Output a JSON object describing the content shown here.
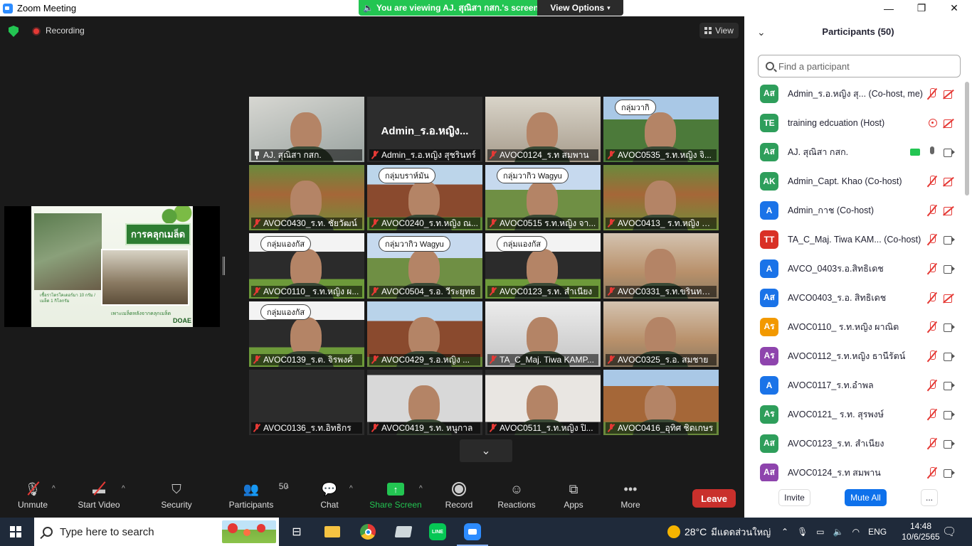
{
  "window": {
    "title": "Zoom Meeting",
    "share_banner": "You are viewing AJ. สุณิสา กสก.'s screen",
    "view_options": "View Options",
    "minimize": "—",
    "restore": "❐",
    "close": "✕"
  },
  "topbar": {
    "recording_label": "Recording",
    "view_label": "View"
  },
  "slide": {
    "title": "การคลุกเมล็ด",
    "caption": "เชื้อราไตรโคเดอร์มา 10 กรัม / เมล็ด 1 กิโลกรัม",
    "caption2": "เพาะเมล็ดหลังจากคลุกเมล็ด",
    "logo": "DOAE"
  },
  "gallery": {
    "tiles": [
      {
        "name": "AJ. สุณิสา กสก.",
        "pinned": true,
        "muted": false,
        "active": true
      },
      {
        "name": "Admin_ร.อ.หญิง สุชรินทร์",
        "big_name": "Admin_ร.อ.หญิง...",
        "muted": true
      },
      {
        "name": "AVOC0124_ร.ท สมพาน",
        "muted": true
      },
      {
        "name": "AVOC0535_ร.ท.หญิง จิ...",
        "bubble": "กลุ่มวากิ",
        "muted": true
      },
      {
        "name": "AVOC0430_ร.ท. ชัยวัฒน์",
        "muted": true
      },
      {
        "name": "AVOC0240_ร.ท.หญิง ณ...",
        "bubble": "กลุ่มบราห์มัน",
        "muted": true
      },
      {
        "name": "AVOC0515 ร.ท.หญิง จา...",
        "bubble": "กลุ่มวากิว Wagyu",
        "muted": true
      },
      {
        "name": "AVOC0413_ ร.ท.หญิง ชั...",
        "muted": true
      },
      {
        "name": "AVOC0110_ ร.ท.หญิง ผ...",
        "bubble": "กลุ่มแองกัส",
        "muted": true
      },
      {
        "name": "AVOC0504_ร.อ. วีระยุทธ",
        "bubble": "กลุ่มวากิว Wagyu",
        "muted": true
      },
      {
        "name": "AVOC0123_ร.ท. สำเนียง",
        "bubble": "กลุ่มแองกัส",
        "muted": true
      },
      {
        "name": "AVOC0331_ร.ท.ขรินทร์ธร",
        "muted": true
      },
      {
        "name": "AVOC0139_ร.ต. จิรพงศ์",
        "bubble": "กลุ่มแองกัส",
        "muted": true
      },
      {
        "name": "AVOC0429_ร.อ.หญิง ...",
        "muted": true
      },
      {
        "name": "TA_C_Maj. Tiwa KAMP...",
        "muted": true
      },
      {
        "name": "AVOC0325_ร.อ. สมชาย",
        "muted": true
      },
      {
        "name": "AVOC0136_ร.ท.อิทธิกร",
        "muted": true
      },
      {
        "name": "AVOC0419_ร.ท. หนูกาล",
        "muted": true
      },
      {
        "name": "AVOC0511_ร.ท.หญิง ปิ...",
        "muted": true
      },
      {
        "name": "AVOC0416_อุทิศ ชิดเกษร",
        "muted": true
      }
    ]
  },
  "toolbar": {
    "unmute": "Unmute",
    "start_video": "Start Video",
    "security": "Security",
    "participants": "Participants",
    "participants_count": "50",
    "chat": "Chat",
    "share_screen": "Share Screen",
    "record": "Record",
    "reactions": "Reactions",
    "apps": "Apps",
    "more": "More",
    "leave": "Leave"
  },
  "panel": {
    "title": "Participants (50)",
    "search_placeholder": "Find a participant",
    "participants": [
      {
        "initials": "Aส",
        "color": "#2e9e5b",
        "name": "Admin_ร.อ.หญิง สุ...  (Co-host, me)",
        "mic": "muted",
        "cam": "off"
      },
      {
        "initials": "TE",
        "color": "#2e9e5b",
        "name": "training edcuation (Host)",
        "mic": "rec",
        "cam": "off"
      },
      {
        "initials": "Aส",
        "color": "#2e9e5b",
        "name": "AJ. สุณิสา กสก.",
        "mic": "on",
        "cam": "on",
        "sharing": true
      },
      {
        "initials": "AK",
        "color": "#2e9e5b",
        "name": "Admin_Capt. Khao (Co-host)",
        "mic": "muted",
        "cam": "off"
      },
      {
        "initials": "A",
        "color": "#1a73e8",
        "name": "Admin_กาช (Co-host)",
        "mic": "muted",
        "cam": "off"
      },
      {
        "initials": "TT",
        "color": "#d93025",
        "name": "TA_C_Maj. Tiwa KAM...  (Co-host)",
        "mic": "muted",
        "cam": "on"
      },
      {
        "initials": "A",
        "color": "#1a73e8",
        "name": "AVCO_0403ร.อ.สิทธิเดช",
        "mic": "muted",
        "cam": "on"
      },
      {
        "initials": "Aส",
        "color": "#1a73e8",
        "name": "AVCO0403_ร.อ. สิทธิเดช",
        "mic": "muted",
        "cam": "off"
      },
      {
        "initials": "Aร",
        "color": "#f29900",
        "name": "AVOC0110_ ร.ท.หญิง ผาณิต",
        "mic": "muted",
        "cam": "on"
      },
      {
        "initials": "Aร",
        "color": "#8e44ad",
        "name": "AVOC0112_ร.ท.หญิง ธานีรัตน์",
        "mic": "muted",
        "cam": "on"
      },
      {
        "initials": "A",
        "color": "#1a73e8",
        "name": "AVOC0117_ร.ท.อำพล",
        "mic": "muted",
        "cam": "on"
      },
      {
        "initials": "Aร",
        "color": "#2e9e5b",
        "name": "AVOC0121_ ร.ท. สุรพงษ์",
        "mic": "muted",
        "cam": "on"
      },
      {
        "initials": "Aส",
        "color": "#2e9e5b",
        "name": "AVOC0123_ร.ท. สำเนียง",
        "mic": "muted",
        "cam": "on"
      },
      {
        "initials": "Aส",
        "color": "#8e44ad",
        "name": "AVOC0124_ร.ท สมพาน",
        "mic": "muted",
        "cam": "on"
      }
    ],
    "invite": "Invite",
    "mute_all": "Mute All",
    "more": "..."
  },
  "taskbar": {
    "search_placeholder": "Type here to search",
    "weather_temp": "28°C",
    "weather_desc": "มีแดดส่วนใหญ่",
    "language": "ENG",
    "time": "14:48",
    "date": "10/6/2565"
  }
}
